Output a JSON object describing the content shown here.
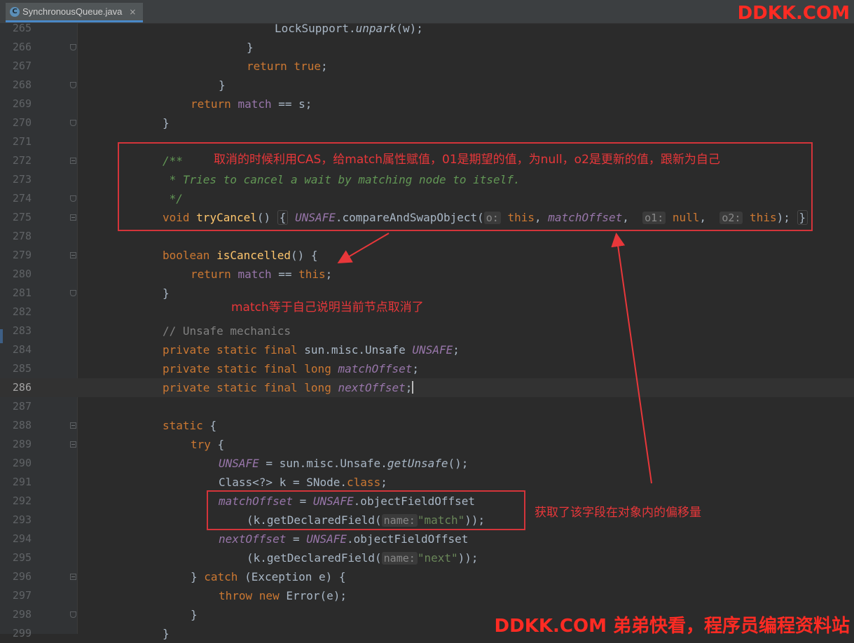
{
  "tab": {
    "icon": "java-class-icon",
    "label": "SynchronousQueue.java",
    "close": "×"
  },
  "colors": {
    "background": "#2b2b2b",
    "keyword": "#cc7832",
    "field": "#9876aa",
    "method": "#ffc66d",
    "string": "#6a8759",
    "annotation_red": "#e8373a"
  },
  "lines": [
    {
      "n": "265",
      "fold": "none",
      "indent": 4,
      "t": [
        [
          "",
          "LockSupport."
        ],
        [
          "it",
          "unpark"
        ],
        [
          "",
          "(w);"
        ]
      ]
    },
    {
      "n": "266",
      "fold": "end",
      "indent": 3,
      "t": [
        [
          "",
          "}"
        ]
      ]
    },
    {
      "n": "267",
      "fold": "none",
      "indent": 3,
      "t": [
        [
          "kw",
          "return true"
        ],
        [
          "",
          ";"
        ]
      ]
    },
    {
      "n": "268",
      "fold": "end",
      "indent": 2,
      "t": [
        [
          "",
          "}"
        ]
      ]
    },
    {
      "n": "269",
      "fold": "none",
      "indent": 1,
      "t": [
        [
          "kw",
          "return "
        ],
        [
          "fld-n",
          "match"
        ],
        [
          "",
          " == s;"
        ]
      ]
    },
    {
      "n": "270",
      "fold": "end",
      "indent": 0,
      "t": [
        [
          "",
          "}"
        ]
      ]
    },
    {
      "n": "271",
      "fold": "none",
      "indent": 0,
      "t": []
    },
    {
      "n": "272",
      "fold": "open",
      "indent": 0,
      "t": [
        [
          "doc",
          "/**"
        ]
      ]
    },
    {
      "n": "273",
      "fold": "none",
      "indent": 0,
      "t": [
        [
          "doc",
          " * Tries to cancel a wait by matching node to itself."
        ]
      ]
    },
    {
      "n": "274",
      "fold": "end",
      "indent": 0,
      "t": [
        [
          "doc",
          " */"
        ]
      ]
    },
    {
      "n": "275",
      "fold": "open",
      "indent": 0,
      "t": [
        [
          "kw",
          "void "
        ],
        [
          "fn",
          "tryCancel"
        ],
        [
          "",
          "() "
        ],
        [
          "brace",
          "{"
        ],
        [
          "",
          " "
        ],
        [
          "fld",
          "UNSAFE"
        ],
        [
          "",
          ".compareAndSwapObject("
        ],
        [
          "hint",
          "o:"
        ],
        [
          "kw",
          " this"
        ],
        [
          "",
          ", "
        ],
        [
          "fld",
          "matchOffset"
        ],
        [
          "",
          ",  "
        ],
        [
          "hint",
          "o1:"
        ],
        [
          "kw",
          " null"
        ],
        [
          "",
          ",  "
        ],
        [
          "hint",
          "o2:"
        ],
        [
          "kw",
          " this"
        ],
        [
          "",
          "); "
        ],
        [
          "brace",
          "}"
        ]
      ]
    },
    {
      "n": "278",
      "fold": "none",
      "indent": 0,
      "t": []
    },
    {
      "n": "279",
      "fold": "open",
      "indent": 0,
      "t": [
        [
          "kw",
          "boolean "
        ],
        [
          "fn",
          "isCancelled"
        ],
        [
          "",
          "() {"
        ]
      ]
    },
    {
      "n": "280",
      "fold": "none",
      "indent": 1,
      "t": [
        [
          "kw",
          "return "
        ],
        [
          "fld-n",
          "match"
        ],
        [
          "",
          " == "
        ],
        [
          "kw",
          "this"
        ],
        [
          "",
          ";"
        ]
      ]
    },
    {
      "n": "281",
      "fold": "end",
      "indent": 0,
      "t": [
        [
          "",
          "}"
        ]
      ]
    },
    {
      "n": "282",
      "fold": "none",
      "indent": 0,
      "t": []
    },
    {
      "n": "283",
      "fold": "none",
      "indent": 0,
      "t": [
        [
          "cm",
          "// Unsafe mechanics"
        ]
      ]
    },
    {
      "n": "284",
      "fold": "none",
      "indent": 0,
      "t": [
        [
          "kw",
          "private static final "
        ],
        [
          "",
          "sun.misc.Unsafe "
        ],
        [
          "fld",
          "UNSAFE"
        ],
        [
          "",
          ";"
        ]
      ]
    },
    {
      "n": "285",
      "fold": "none",
      "indent": 0,
      "t": [
        [
          "kw",
          "private static final long "
        ],
        [
          "fld",
          "matchOffset"
        ],
        [
          "",
          ";"
        ]
      ]
    },
    {
      "n": "286",
      "fold": "none",
      "indent": 0,
      "current": true,
      "caret": true,
      "t": [
        [
          "kw",
          "private static final long "
        ],
        [
          "fld",
          "nextOffset"
        ],
        [
          "",
          ";"
        ]
      ]
    },
    {
      "n": "287",
      "fold": "none",
      "indent": 0,
      "t": []
    },
    {
      "n": "288",
      "fold": "open",
      "indent": 0,
      "t": [
        [
          "kw",
          "static "
        ],
        [
          "",
          "{"
        ]
      ]
    },
    {
      "n": "289",
      "fold": "open",
      "indent": 1,
      "t": [
        [
          "kw",
          "try "
        ],
        [
          "",
          "{"
        ]
      ]
    },
    {
      "n": "290",
      "fold": "none",
      "indent": 2,
      "t": [
        [
          "fld",
          "UNSAFE"
        ],
        [
          "",
          " = sun.misc.Unsafe."
        ],
        [
          "it",
          "getUnsafe"
        ],
        [
          "",
          "();"
        ]
      ]
    },
    {
      "n": "291",
      "fold": "none",
      "indent": 2,
      "t": [
        [
          "",
          "Class<?> k = SNode."
        ],
        [
          "kw",
          "class"
        ],
        [
          "",
          ";"
        ]
      ]
    },
    {
      "n": "292",
      "fold": "none",
      "indent": 2,
      "t": [
        [
          "fld",
          "matchOffset"
        ],
        [
          "",
          " = "
        ],
        [
          "fld",
          "UNSAFE"
        ],
        [
          "",
          ".objectFieldOffset"
        ]
      ]
    },
    {
      "n": "293",
      "fold": "none",
      "indent": 3,
      "t": [
        [
          "",
          "(k.getDeclaredField("
        ],
        [
          "hint",
          "name:"
        ],
        [
          "str",
          "\"match\""
        ],
        [
          "",
          "));"
        ]
      ]
    },
    {
      "n": "294",
      "fold": "none",
      "indent": 2,
      "t": [
        [
          "fld",
          "nextOffset"
        ],
        [
          "",
          " = "
        ],
        [
          "fld",
          "UNSAFE"
        ],
        [
          "",
          ".objectFieldOffset"
        ]
      ]
    },
    {
      "n": "295",
      "fold": "none",
      "indent": 3,
      "t": [
        [
          "",
          "(k.getDeclaredField("
        ],
        [
          "hint",
          "name:"
        ],
        [
          "str",
          "\"next\""
        ],
        [
          "",
          "));"
        ]
      ]
    },
    {
      "n": "296",
      "fold": "open",
      "indent": 1,
      "t": [
        [
          "",
          "} "
        ],
        [
          "kw",
          "catch "
        ],
        [
          "",
          "(Exception e) {"
        ]
      ]
    },
    {
      "n": "297",
      "fold": "none",
      "indent": 2,
      "t": [
        [
          "kw",
          "throw new "
        ],
        [
          "",
          "Error(e);"
        ]
      ]
    },
    {
      "n": "298",
      "fold": "end",
      "indent": 1,
      "t": [
        [
          "",
          "}"
        ]
      ]
    },
    {
      "n": "299",
      "fold": "none",
      "indent": 0,
      "t": [
        [
          "",
          "}"
        ]
      ]
    }
  ],
  "annotations": {
    "cas_note": "取消的时候利用CAS，给match属性赋值，01是期望的值，为null，o2是更新的值，跟新为自己",
    "match_note": "match等于自己说明当前节点取消了",
    "offset_note": "获取了该字段在对象内的偏移量"
  },
  "watermark": {
    "top": "DDKK.COM",
    "bottom": "DDKK.COM 弟弟快看，程序员编程资料站"
  }
}
